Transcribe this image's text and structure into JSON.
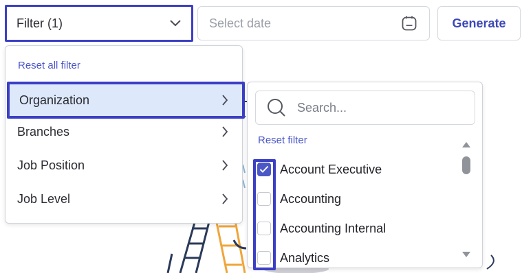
{
  "filter": {
    "label": "Filter (1)",
    "chevron_icon": "chevron-down-icon"
  },
  "date": {
    "placeholder": "Select date",
    "icon": "calendar-icon"
  },
  "generate": {
    "label": "Generate"
  },
  "menu": {
    "reset_all": "Reset all filter",
    "items": [
      {
        "label": "Organization",
        "active": true
      },
      {
        "label": "Branches",
        "active": false
      },
      {
        "label": "Job Position",
        "active": false
      },
      {
        "label": "Job Level",
        "active": false
      }
    ]
  },
  "submenu": {
    "search_placeholder": "Search...",
    "reset_filter": "Reset filter",
    "options": [
      {
        "label": "Account Executive",
        "checked": true
      },
      {
        "label": "Accounting",
        "checked": false
      },
      {
        "label": "Accounting Internal",
        "checked": false
      },
      {
        "label": "Analytics",
        "checked": false
      }
    ]
  },
  "colors": {
    "accent": "#4b57c7",
    "highlight_border": "#3b3fc4",
    "active_bg": "#dde9fb"
  }
}
